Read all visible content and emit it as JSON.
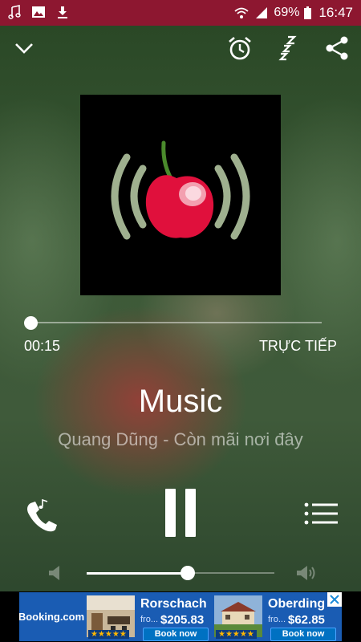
{
  "status_bar": {
    "battery_percent": "69%",
    "time": "16:47",
    "left_icons": [
      "music-note-icon",
      "image-icon",
      "download-icon"
    ],
    "right_icons": [
      "wifi-icon",
      "signal-icon",
      "battery-icon"
    ]
  },
  "toolbar": {
    "icons": [
      "chevron-down-icon",
      "alarm-icon",
      "sleep-icon",
      "share-icon"
    ]
  },
  "player": {
    "elapsed": "00:15",
    "live_label": "TRỰC TIẾP",
    "title": "Music",
    "subtitle": "Quang Dũng - Còn mãi nơi đây",
    "progress_fraction": 0.0,
    "volume_fraction": 0.54
  },
  "ad": {
    "logo": "Booking.com",
    "offers": [
      {
        "city": "Rorschach",
        "from": "fro...",
        "price": "$205.83",
        "book": "Book now",
        "stars": "★★★★★"
      },
      {
        "city": "Oberding",
        "from": "fro...",
        "price": "$62.85",
        "book": "Book now",
        "stars": "★★★★★"
      }
    ]
  },
  "colors": {
    "status_bar": "#8d1730",
    "cherry": "#e0103c",
    "arc": "#9fb08f"
  }
}
